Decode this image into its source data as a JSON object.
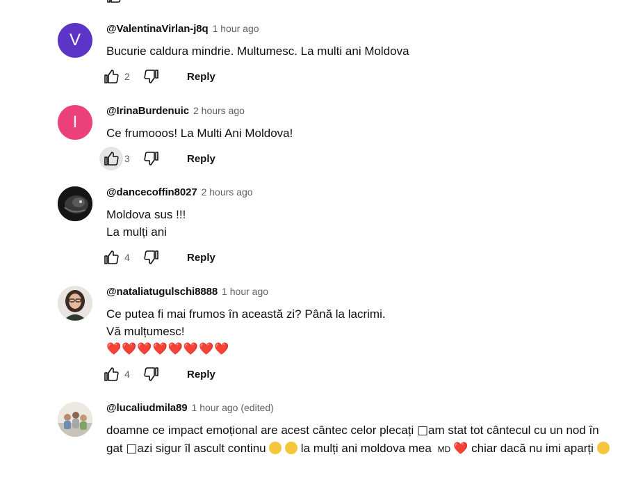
{
  "comments": [
    {
      "author": "@ValentinaVirlan-j8q",
      "time": "1 hour ago",
      "avatar_letter": "V",
      "avatar_color": "#5c35c7",
      "lines": [
        "Bucurie caldura mindrie. Multumesc. La multi ani Moldova"
      ],
      "likes": "2",
      "reply": "Reply"
    },
    {
      "author": "@IrinaBurdenuic",
      "time": "2 hours ago",
      "avatar_letter": "I",
      "avatar_color": "#ec407a",
      "lines": [
        "Ce frumooos! La Multi Ani Moldova!"
      ],
      "likes": "3",
      "reply": "Reply"
    },
    {
      "author": "@dancecoffin8027",
      "time": "2 hours ago",
      "lines": [
        "Moldova sus !!!",
        "La mulți ani"
      ],
      "likes": "4",
      "reply": "Reply"
    },
    {
      "author": "@nataliatugulschi8888",
      "time": "1 hour ago",
      "lines": [
        "Ce putea fi mai frumos în această zi? Până la lacrimi.",
        "Vă mulțumesc!"
      ],
      "hearts": "❤️❤️❤️❤️❤️❤️❤️❤️",
      "likes": "4",
      "reply": "Reply"
    },
    {
      "author": "@lucaliudmila89",
      "time": "1 hour ago (edited)",
      "text_part1": "doamne ce impact emoțional are acest cântec celor plecați ",
      "box_char": "□",
      "text_part2": "am stat tot cântecul cu un nod în gat ",
      "text_part3": "azi sigur îl ascult continu ",
      "text_part4": " la mulți ani moldova mea ",
      "flag_text": "MD",
      "text_part5": " chiar dacă nu imi aparți"
    }
  ]
}
